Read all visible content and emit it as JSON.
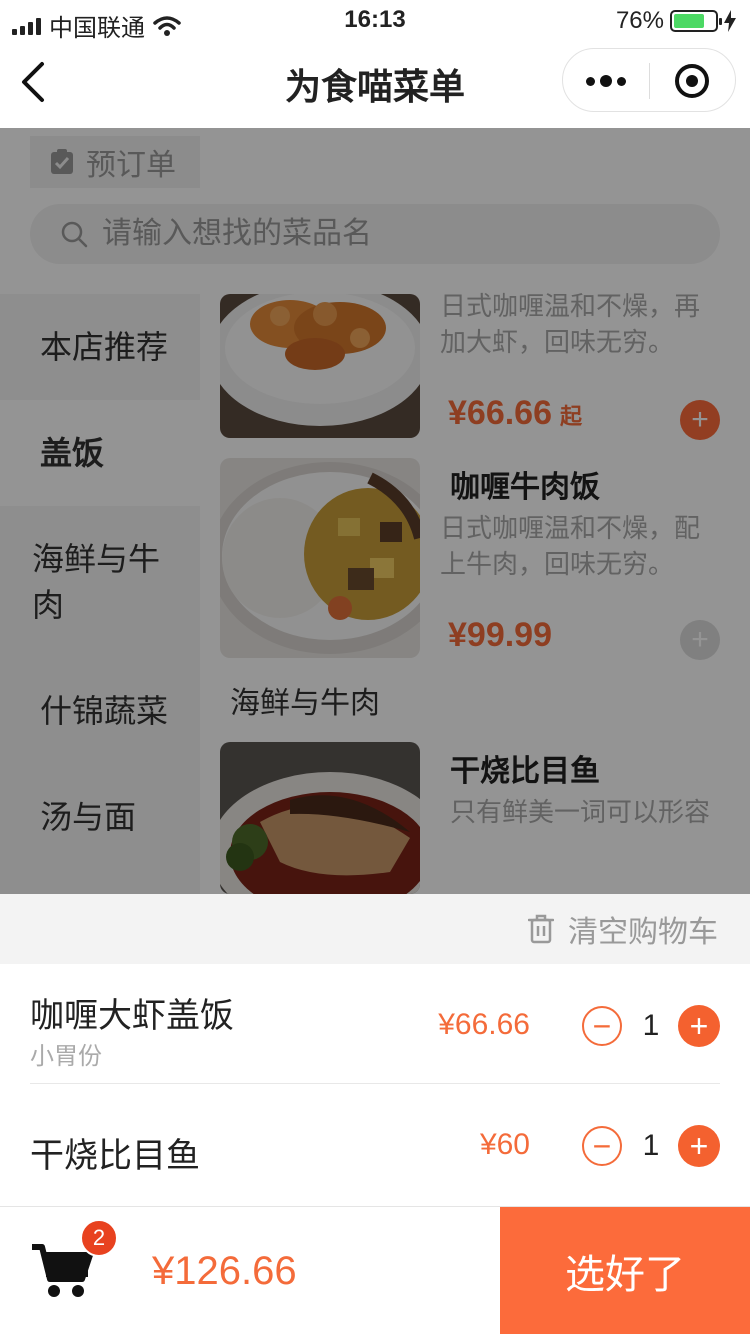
{
  "status_bar": {
    "carrier": "中国联通",
    "time": "16:13",
    "battery_percent": "76%",
    "battery_level": 0.76,
    "icons": [
      "signal-icon",
      "wifi-icon",
      "battery-icon",
      "charging-icon"
    ]
  },
  "nav": {
    "title": "为食喵菜单",
    "icons": [
      "back-icon",
      "more-icon",
      "close-target-icon"
    ]
  },
  "menu": {
    "preorder_label": "预订单",
    "search_placeholder": "请输入想找的菜品名",
    "categories": [
      "本店推荐",
      "盖饭",
      "海鲜与牛肉",
      "什锦蔬菜",
      "汤与面"
    ],
    "active_category": "盖饭",
    "section_title": "海鲜与牛肉",
    "dishes": [
      {
        "name": "",
        "desc": "日式咖喱温和不燥，再加大虾，回味无穷。",
        "price": "¥66.66",
        "price_suffix": "起"
      },
      {
        "name": "咖喱牛肉饭",
        "desc": "日式咖喱温和不燥，配上牛肉，回味无穷。",
        "price": "¥99.99",
        "price_suffix": ""
      },
      {
        "name": "干烧比目鱼",
        "desc": "只有鲜美一词可以形容",
        "price": "",
        "price_suffix": ""
      }
    ]
  },
  "cart": {
    "clear_label": "清空购物车",
    "items": [
      {
        "name": "咖喱大虾盖饭",
        "spec": "小胃份",
        "price": "¥66.66",
        "qty": "1"
      },
      {
        "name": "干烧比目鱼",
        "spec": "",
        "price": "¥60",
        "qty": "1"
      }
    ],
    "badge_count": "2",
    "total": "¥126.66",
    "checkout_label": "选好了"
  },
  "colors": {
    "accent": "#fc6b3b",
    "price": "#f46b3a",
    "battery": "#4cd964",
    "badge": "#e8421f"
  }
}
